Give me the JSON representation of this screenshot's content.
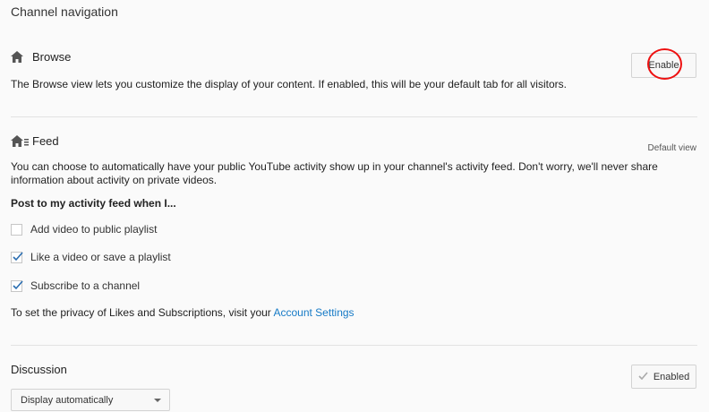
{
  "page": {
    "title": "Channel navigation"
  },
  "browse": {
    "title": "Browse",
    "icon": "home-icon",
    "description": "The Browse view lets you customize the display of your content. If enabled, this will be your default tab for all visitors.",
    "button_label": "Enable"
  },
  "feed": {
    "title": "Feed",
    "icon": "home-feed-icon",
    "default_view_label": "Default view",
    "description_line1": "You can choose to automatically have your public YouTube activity show up in your channel's activity feed. Don't worry, we'll never share",
    "description_line2": "information about activity on private videos.",
    "post_heading": "Post to my activity feed when I...",
    "options": [
      {
        "label": "Add video to public playlist",
        "checked": false
      },
      {
        "label": "Like a video or save a playlist",
        "checked": true
      },
      {
        "label": "Subscribe to a channel",
        "checked": true
      }
    ],
    "privacy_text": "To set the privacy of Likes and Subscriptions, visit your ",
    "privacy_link": "Account Settings"
  },
  "discussion": {
    "title": "Discussion",
    "button_label": "Enabled",
    "select_value": "Display automatically"
  },
  "colors": {
    "link": "#167ac6",
    "annotation": "#ee1111"
  }
}
